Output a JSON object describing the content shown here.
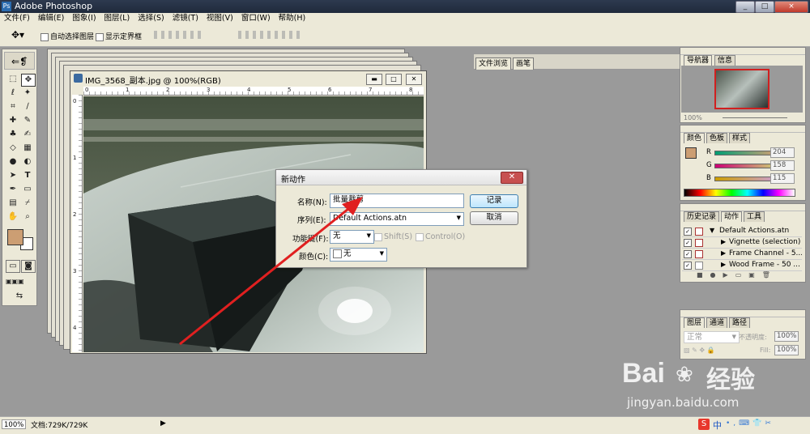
{
  "app": {
    "title": "Adobe Photoshop",
    "window_buttons": [
      "_",
      "□",
      "×"
    ]
  },
  "menu": [
    "文件(F)",
    "编辑(E)",
    "图象(I)",
    "图层(L)",
    "选择(S)",
    "滤镜(T)",
    "视图(V)",
    "窗口(W)",
    "帮助(H)"
  ],
  "options": {
    "auto_select": "自动选择图层",
    "show_bounds": "显示定界框"
  },
  "well_tabs": [
    "文件浏览",
    "画笔"
  ],
  "document": {
    "title": "IMG_3568_副本.jpg @ 100%(RGB)",
    "ruler_h": [
      "0",
      "1",
      "2",
      "3",
      "4",
      "5",
      "6",
      "7",
      "8"
    ],
    "ruler_v": [
      "0",
      "1",
      "2",
      "3",
      "4"
    ]
  },
  "dialog": {
    "title": "新动作",
    "name_label": "名称(N):",
    "name_value": "批量裁剪",
    "set_label": "序列(E):",
    "set_value": "Default Actions.atn",
    "fkey_label": "功能键(F):",
    "fkey_value": "无",
    "shift": "Shift(S)",
    "control": "Control(O)",
    "color_label": "颜色(C):",
    "color_value": "无",
    "record": "记录",
    "cancel": "取消"
  },
  "navigator": {
    "tabs": [
      "导航器",
      "信息"
    ],
    "zoom": "100%"
  },
  "color": {
    "tabs": [
      "颜色",
      "色板",
      "样式"
    ],
    "r_label": "R",
    "g_label": "G",
    "b_label": "B",
    "r": "204",
    "g": "158",
    "b": "115",
    "fg": "#cc9e73"
  },
  "actions": {
    "tabs": [
      "历史记录",
      "动作",
      "工具"
    ],
    "items": [
      {
        "label": "Default Actions.atn"
      },
      {
        "label": "Vignette (selection)"
      },
      {
        "label": "Frame Channel - 5..."
      },
      {
        "label": "Wood Frame - 50 ..."
      }
    ]
  },
  "layers": {
    "tabs": [
      "图层",
      "通道",
      "路径"
    ],
    "mode": "正常",
    "opacity_label": "不透明度:",
    "opacity": "100%",
    "fill_label": "Fill:",
    "fill": "100%"
  },
  "status": {
    "zoom": "100%",
    "doc": "文档:729K/729K"
  },
  "watermark": {
    "brand": "Bai",
    "brand2": "经验",
    "url": "jingyan.baidu.com"
  },
  "tray": {
    "ime": "中"
  }
}
